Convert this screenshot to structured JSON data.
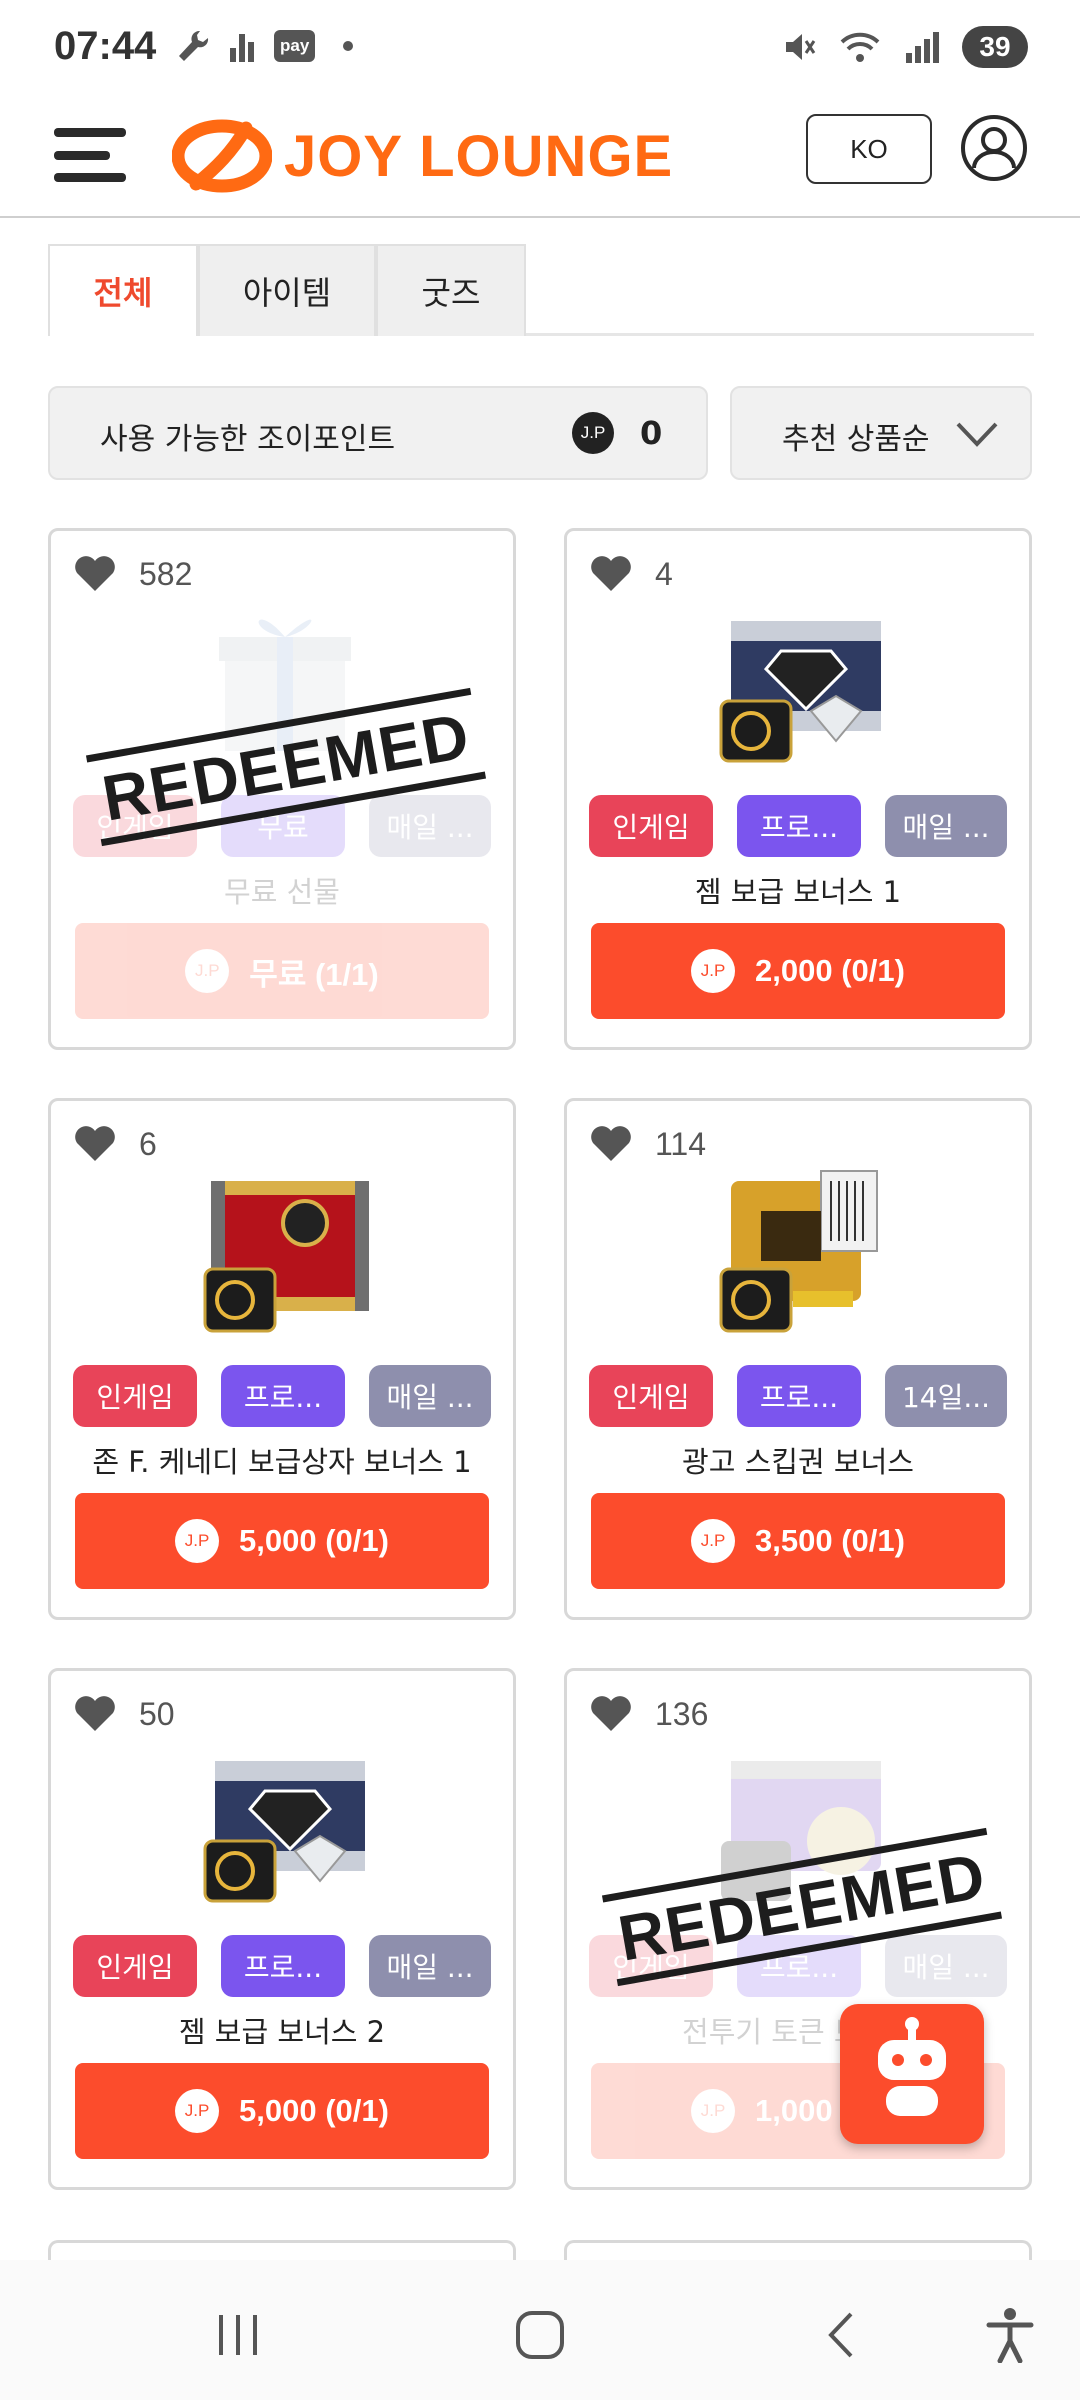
{
  "status_bar": {
    "time": "07:44",
    "pay_label": "pay",
    "battery": "39",
    "icons": [
      "wrench-icon",
      "signal-bars-icon",
      "pay-icon",
      "notification-dot-icon",
      "mute-icon",
      "wifi-icon",
      "cell-signal-icon"
    ]
  },
  "header": {
    "logo_text": "JOY LOUNGE",
    "language": "KO",
    "menu_icon": "hamburger-menu-icon",
    "profile_icon": "user-profile-icon"
  },
  "tabs": [
    {
      "label": "전체",
      "active": true
    },
    {
      "label": "아이템",
      "active": false
    },
    {
      "label": "굿즈",
      "active": false
    }
  ],
  "points": {
    "label": "사용 가능한 조이포인트",
    "badge": "J.P",
    "value": "0"
  },
  "sort": {
    "label": "추천 상품순",
    "icon": "chevron-down-icon"
  },
  "stamp_text": "REDEEMED",
  "currency_badge": "J.P",
  "products": [
    {
      "likes": "582",
      "tags": [
        "인게임",
        "무료",
        "매일 ..."
      ],
      "name": "무료 선물",
      "price": "무료 (1/1)",
      "redeemed": true,
      "thumb": "gift-box"
    },
    {
      "likes": "4",
      "tags": [
        "인게임",
        "프로...",
        "매일 ..."
      ],
      "name": "젬 보급 보너스 1",
      "price": "2,000 (0/1)",
      "redeemed": false,
      "thumb": "gem-crate"
    },
    {
      "likes": "6",
      "tags": [
        "인게임",
        "프로...",
        "매일 ..."
      ],
      "name": "존 F. 케네디 보급상자 보너스 1",
      "price": "5,000 (0/1)",
      "redeemed": false,
      "thumb": "red-crate"
    },
    {
      "likes": "114",
      "tags": [
        "인게임",
        "프로...",
        "14일..."
      ],
      "name": "광고 스킵권 보너스",
      "price": "3,500 (0/1)",
      "redeemed": false,
      "thumb": "gold-ticket"
    },
    {
      "likes": "50",
      "tags": [
        "인게임",
        "프로...",
        "매일 ..."
      ],
      "name": "젬 보급 보너스 2",
      "price": "5,000 (0/1)",
      "redeemed": false,
      "thumb": "gem-crate"
    },
    {
      "likes": "136",
      "tags": [
        "인게임",
        "프로...",
        "매일 ..."
      ],
      "name": "전투기 토큰 보너스",
      "price": "1,000 (0/1)",
      "redeemed": true,
      "thumb": "purple-crate"
    }
  ],
  "fab": {
    "icon": "chatbot-robot-icon"
  },
  "nav": {
    "icons": [
      "recent-apps-icon",
      "home-icon",
      "back-icon",
      "accessibility-icon"
    ]
  },
  "colors": {
    "brand": "#ff6a13",
    "buy_button": "#fc4c2c",
    "tag_ingame": "#e84459",
    "tag_promo": "#7b55ee",
    "tag_period": "#8e8fad",
    "active_tab": "#ef4a2e"
  }
}
